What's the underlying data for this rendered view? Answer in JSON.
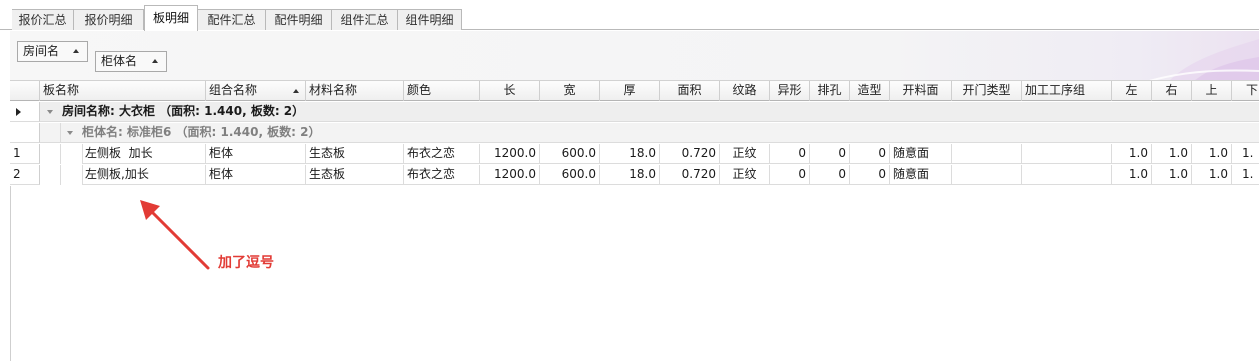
{
  "tabs": [
    {
      "label": "报价汇总"
    },
    {
      "label": "报价明细"
    },
    {
      "label": "板明细",
      "active": true
    },
    {
      "label": "配件汇总"
    },
    {
      "label": "配件明细"
    },
    {
      "label": "组件汇总"
    },
    {
      "label": "组件明细"
    }
  ],
  "group_panel": {
    "tags": [
      "房间名",
      "柜体名"
    ]
  },
  "grid": {
    "columns": [
      "板名称",
      "组合名称",
      "材料名称",
      "颜色",
      "长",
      "宽",
      "厚",
      "面积",
      "纹路",
      "异形",
      "排孔",
      "造型",
      "开料面",
      "开门类型",
      "加工工序组",
      "左",
      "右",
      "上",
      "下"
    ],
    "sorted_column": "组合名称",
    "group_level1": "房间名称: 大衣柜 （面积: 1.440, 板数: 2）",
    "group_level2": "柜体名: 标准柜6 （面积: 1.440, 板数: 2）",
    "rows": [
      {
        "n": "1",
        "cells": [
          "左侧板  加长",
          "柜体",
          "生态板",
          "布衣之恋",
          "1200.0",
          "600.0",
          "18.0",
          "0.720",
          "正纹",
          "0",
          "0",
          "0",
          "随意面",
          "",
          "",
          "1.0",
          "1.0",
          "1.0",
          "1."
        ]
      },
      {
        "n": "2",
        "cells": [
          "左侧板,加长",
          "柜体",
          "生态板",
          "布衣之恋",
          "1200.0",
          "600.0",
          "18.0",
          "0.720",
          "正纹",
          "0",
          "0",
          "0",
          "随意面",
          "",
          "",
          "1.0",
          "1.0",
          "1.0",
          "1."
        ]
      }
    ]
  },
  "annotation": {
    "text": "加了逗号",
    "color": "#e23b35"
  }
}
